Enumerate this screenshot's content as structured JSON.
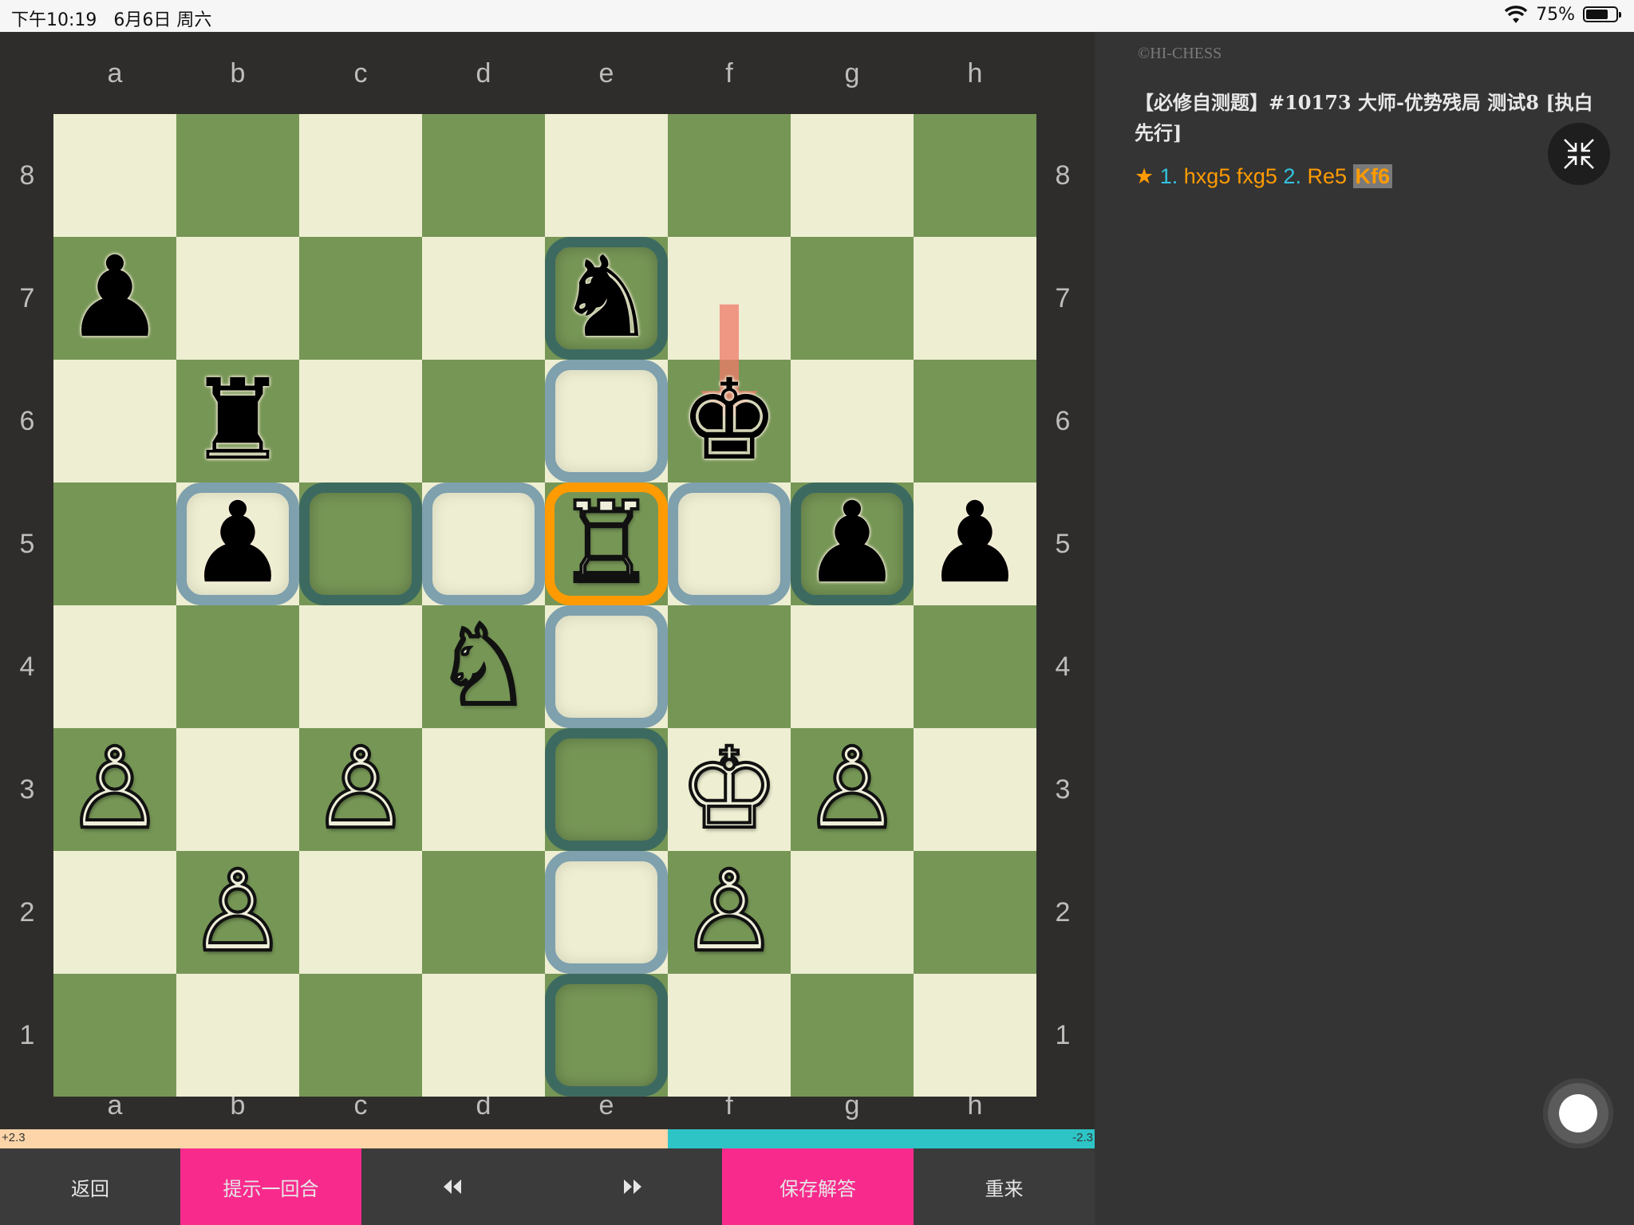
{
  "status_bar": {
    "time": "下午10:19",
    "date": "6月6日 周六",
    "battery": "75%",
    "battery_level": 0.75
  },
  "board": {
    "files": [
      "a",
      "b",
      "c",
      "d",
      "e",
      "f",
      "g",
      "h"
    ],
    "ranks": [
      "8",
      "7",
      "6",
      "5",
      "4",
      "3",
      "2",
      "1"
    ],
    "light_color": "#eeeed2",
    "dark_color": "#769656",
    "pieces": [
      {
        "sq": "a7",
        "glyph": "♟",
        "color": "black",
        "name": "black-pawn-a7"
      },
      {
        "sq": "e7",
        "glyph": "♞",
        "color": "black",
        "name": "black-knight-e7"
      },
      {
        "sq": "b6",
        "glyph": "♜",
        "color": "black",
        "name": "black-rook-b6"
      },
      {
        "sq": "f6",
        "glyph": "♚",
        "color": "black",
        "name": "black-king-f6"
      },
      {
        "sq": "b5",
        "glyph": "♟",
        "color": "black",
        "name": "black-pawn-b5"
      },
      {
        "sq": "e5",
        "glyph": "♖",
        "color": "white",
        "name": "white-rook-e5"
      },
      {
        "sq": "g5",
        "glyph": "♟",
        "color": "black",
        "name": "black-pawn-g5"
      },
      {
        "sq": "h5",
        "glyph": "♟",
        "color": "black",
        "name": "black-pawn-h5"
      },
      {
        "sq": "d4",
        "glyph": "♘",
        "color": "white",
        "name": "white-knight-d4"
      },
      {
        "sq": "a3",
        "glyph": "♙",
        "color": "white",
        "name": "white-pawn-a3"
      },
      {
        "sq": "c3",
        "glyph": "♙",
        "color": "white",
        "name": "white-pawn-c3"
      },
      {
        "sq": "f3",
        "glyph": "♔",
        "color": "white",
        "name": "white-king-f3"
      },
      {
        "sq": "g3",
        "glyph": "♙",
        "color": "white",
        "name": "white-pawn-g3"
      },
      {
        "sq": "b2",
        "glyph": "♙",
        "color": "white",
        "name": "white-pawn-b2"
      },
      {
        "sq": "f2",
        "glyph": "♙",
        "color": "white",
        "name": "white-pawn-f2"
      }
    ],
    "selected": "e5",
    "move_targets": [
      "e7",
      "e6",
      "b5",
      "c5",
      "d5",
      "f5",
      "g5",
      "e4",
      "e3",
      "e2",
      "e1"
    ],
    "last_move": {
      "from": "f7",
      "to": "f6"
    },
    "colors": {
      "selected": "#ff9b00",
      "arrow": "#f07a6a"
    }
  },
  "eval": {
    "left_label": "+2.3",
    "right_label": "-2.3",
    "white_share": 0.61,
    "white_color": "#fdd5a8",
    "black_color": "#2ec4c6"
  },
  "buttons": {
    "back": "返回",
    "hint": "提示一回合",
    "save": "保存解答",
    "restart": "重来",
    "prev_icon": "rewind-icon",
    "next_icon": "fast-forward-icon",
    "pink": "#f82b8d"
  },
  "panel": {
    "copyright": "©HI-CHESS",
    "title": "【必修自测题】#10173 大师-优势残局 测试8 [执白先行]",
    "moves": {
      "star": "★",
      "n1": "1.",
      "w1": "hxg5",
      "b1": "fxg5",
      "n2": "2.",
      "w2": "Re5",
      "b2": "Kf6"
    }
  }
}
